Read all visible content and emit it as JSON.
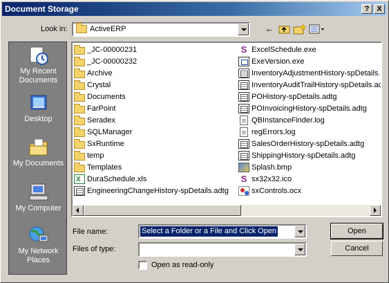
{
  "window": {
    "title": "Document Storage",
    "help_label": "?",
    "close_label": "X"
  },
  "lookin": {
    "label": "Look in:",
    "value": "ActiveERP"
  },
  "places": [
    {
      "label": "My Recent Documents",
      "icon": "recent-documents-icon"
    },
    {
      "label": "Desktop",
      "icon": "desktop-icon"
    },
    {
      "label": "My Documents",
      "icon": "my-documents-icon"
    },
    {
      "label": "My Computer",
      "icon": "my-computer-icon"
    },
    {
      "label": "My Network Places",
      "icon": "network-places-icon"
    }
  ],
  "files_col1": [
    {
      "name": "_JC-00000231",
      "type": "folder"
    },
    {
      "name": "_JC-00000232",
      "type": "folder"
    },
    {
      "name": "Archive",
      "type": "folder"
    },
    {
      "name": "Crystal",
      "type": "folder"
    },
    {
      "name": "Documents",
      "type": "folder"
    },
    {
      "name": "FarPoint",
      "type": "folder"
    },
    {
      "name": "Seradex",
      "type": "folder"
    },
    {
      "name": "SQLManager",
      "type": "folder"
    },
    {
      "name": "SxRuntime",
      "type": "folder"
    },
    {
      "name": "temp",
      "type": "folder"
    },
    {
      "name": "Templates",
      "type": "folder"
    },
    {
      "name": "DuraSchedule.xls",
      "type": "xls"
    },
    {
      "name": "EngineeringChangeHistory-spDetails.adtg",
      "type": "adtg"
    }
  ],
  "files_col2": [
    {
      "name": "ExcelSchedule.exe",
      "type": "exe-s"
    },
    {
      "name": "ExeVersion.exe",
      "type": "exe-v"
    },
    {
      "name": "InventoryAdjustmentHistory-spDetails.a",
      "type": "adtg"
    },
    {
      "name": "InventoryAuditTrailHistory-spDetails.adt",
      "type": "adtg"
    },
    {
      "name": "POHistory-spDetails.adtg",
      "type": "adtg"
    },
    {
      "name": "POInvoicingHistory-spDetails.adtg",
      "type": "adtg"
    },
    {
      "name": "QBInstanceFinder.log",
      "type": "txt"
    },
    {
      "name": "regErrors.log",
      "type": "txt"
    },
    {
      "name": "SalesOrderHistory-spDetails.adtg",
      "type": "adtg"
    },
    {
      "name": "ShippingHistory-spDetails.adtg",
      "type": "adtg"
    },
    {
      "name": "Splash.bmp",
      "type": "bmp"
    },
    {
      "name": "sx32x32.ico",
      "type": "ico"
    },
    {
      "name": "sxControls.ocx",
      "type": "ocx"
    }
  ],
  "filename": {
    "label": "File name:",
    "value": "Select a Folder or a File and Click Open"
  },
  "filetype": {
    "label": "Files of type:",
    "value": ""
  },
  "readonly": {
    "label": "Open as read-only",
    "checked": false
  },
  "buttons": {
    "open": "Open",
    "cancel": "Cancel"
  }
}
